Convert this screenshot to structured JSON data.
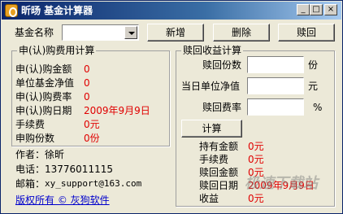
{
  "window": {
    "title": "昕旸 基金计算器",
    "minimize": "_",
    "maximize": "□",
    "close": "×"
  },
  "top_bar": {
    "fund_name_label": "基金名称",
    "fund_name_value": "",
    "add_button": "新增",
    "delete_button": "删除",
    "redeem_button": "赎回"
  },
  "purchase": {
    "title": "申(认)购费用计算",
    "rows": [
      {
        "label": "申(认)购金额",
        "value": "0"
      },
      {
        "label": "单位基金净值",
        "value": "0"
      },
      {
        "label": "申(认)购费率",
        "value": "0"
      },
      {
        "label": "申(认)购日期",
        "value": "2009年9月9日"
      },
      {
        "label": "手续费",
        "value": "0元"
      },
      {
        "label": "申购份数",
        "value": "0份"
      }
    ]
  },
  "redeem": {
    "title": "赎回收益计算",
    "shares_label": "赎回份数",
    "shares_unit": "份",
    "nav_label": "当日单位净值",
    "nav_unit": "元",
    "rate_label": "赎回费率",
    "rate_unit": "%",
    "calc_button": "计算",
    "results": [
      {
        "label": "持有金额",
        "value": "0元"
      },
      {
        "label": "手续费",
        "value": "0元"
      },
      {
        "label": "赎回金额",
        "value": "0元"
      },
      {
        "label": "赎回日期",
        "value": "2009年9月9日"
      },
      {
        "label": "收益",
        "value": "0元"
      }
    ]
  },
  "author": {
    "author_line": "作者：徐昕",
    "phone_line": "电话：13776011115",
    "email_label": "邮箱：",
    "email": "xy_support@163.com",
    "copyright": "版权所有 © 灰狗软件"
  },
  "watermark": "极速下载站"
}
